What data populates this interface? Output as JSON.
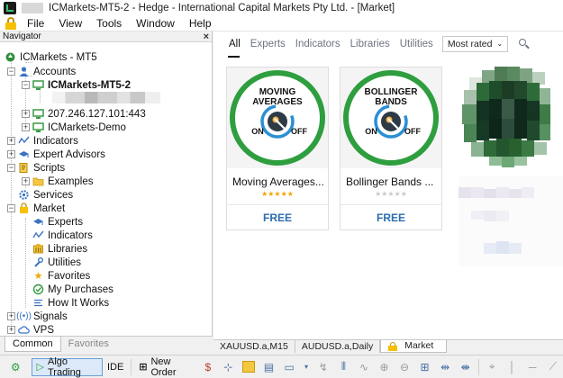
{
  "titlebar": {
    "title": "ICMarkets-MT5-2 - Hedge - International Capital Markets Pty Ltd. - [Market]"
  },
  "menu": [
    "File",
    "View",
    "Tools",
    "Window",
    "Help"
  ],
  "navigator": {
    "title": "Navigator",
    "root": "ICMarkets - MT5",
    "accounts": "Accounts",
    "account_server": "ICMarkets-MT5-2",
    "ip": "207.246.127.101:443",
    "demo": "ICMarkets-Demo",
    "indicators": "Indicators",
    "expert_advisors": "Expert Advisors",
    "scripts": "Scripts",
    "examples": "Examples",
    "services": "Services",
    "market": "Market",
    "market_items": [
      "Experts",
      "Indicators",
      "Libraries",
      "Utilities",
      "Favorites",
      "My Purchases",
      "How It Works"
    ],
    "signals": "Signals",
    "vps": "VPS",
    "tabs": [
      "Common",
      "Favorites"
    ]
  },
  "market": {
    "filters": [
      "All",
      "Experts",
      "Indicators",
      "Libraries",
      "Utilities"
    ],
    "active_filter": "All",
    "sort": "Most rated",
    "products": [
      {
        "logo_line1": "MOVING",
        "logo_line2": "AVERAGES",
        "on": "ON",
        "off": "OFF",
        "name": "Moving Averages...",
        "stars": "★★★★★",
        "rating": 5,
        "price": "FREE"
      },
      {
        "logo_line1": "BOLLINGER",
        "logo_line2": "BANDS",
        "on": "ON",
        "off": "OFF",
        "name": "Bollinger Bands ...",
        "stars": "★★★★★",
        "rating": 0,
        "price": "FREE"
      }
    ],
    "colors": {
      "green": "#2e9e3f",
      "accent": "#2b6cb0",
      "star": "#f0a500"
    }
  },
  "chart_tabs": [
    "XAUUSD.a,M15",
    "AUDUSD.a,Daily",
    "Market"
  ],
  "toolbar": {
    "algo_trading": "Algo Trading",
    "ide": "IDE",
    "new_order": "New Order"
  }
}
